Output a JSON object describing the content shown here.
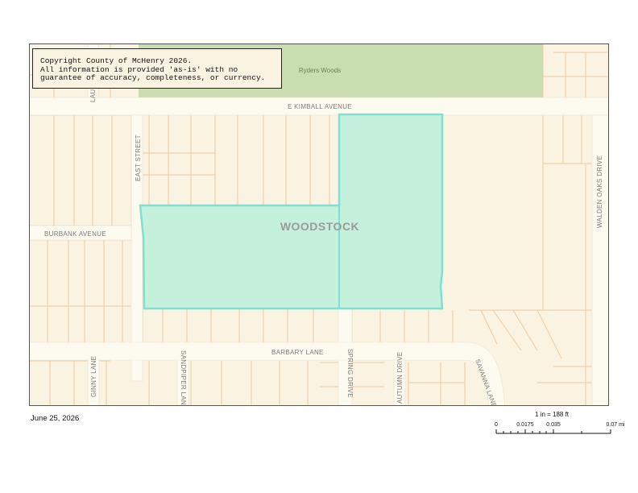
{
  "map": {
    "municipality_label": "WOODSTOCK",
    "woods_label": "Ryders Woods",
    "roads": {
      "kimball": "E  KIMBALL AVENUE",
      "east_street": "EAST STREET",
      "burbank": "BURBANK AVENUE",
      "barbary": "BARBARY LANE",
      "spring": "SPRING DRIVE",
      "autumn": "AUTUMN DRIVE",
      "ginny": "GINNY LANE",
      "sandpiper": "SANDPIPER LANE",
      "savanna": "SAVANNA LANE",
      "walden": "WALDEN OAKS DRIVE",
      "laurel": "LAUREL"
    },
    "colors": {
      "background": "#fbf3e2",
      "parcel_line": "#ecc9a0",
      "road": "#fdfaf0",
      "woods": "#c8ddb0",
      "highlight_fill": "#c5f0dc",
      "highlight_stroke": "#7ee0d2"
    }
  },
  "copyright": {
    "line1": "Copyright County of McHenry 2026.",
    "line2": "All information is provided 'as-is' with no",
    "line3": "guarantee of accuracy, completeness, or currency."
  },
  "date": "June 25, 2026",
  "scale": {
    "ratio_text": "1 in = 188 ft",
    "ticks": [
      "0",
      "0.0175",
      "0.035",
      "0.07 mi"
    ]
  }
}
